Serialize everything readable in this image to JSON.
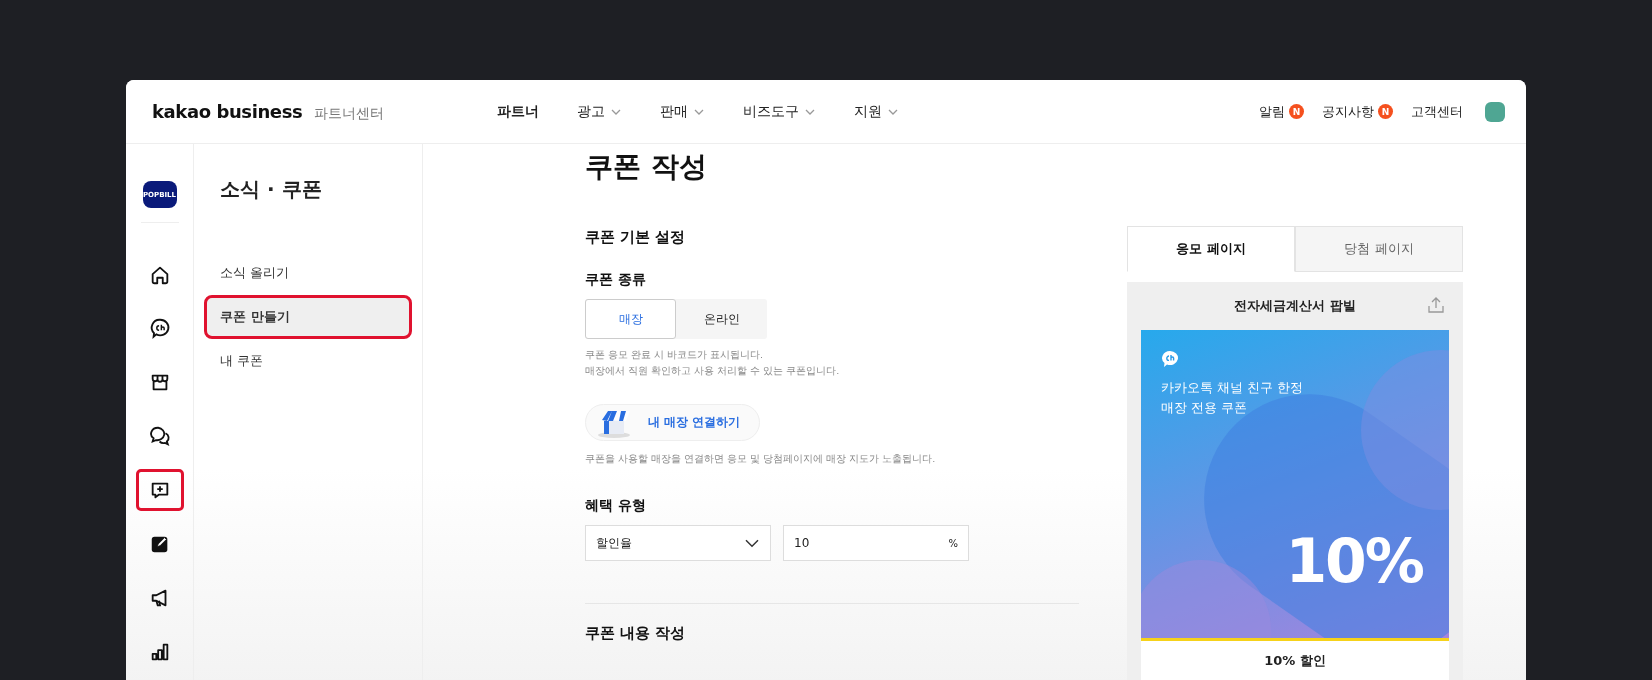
{
  "header": {
    "logo": "kakao business",
    "logo_sub": "파트너센터",
    "nav": [
      {
        "label": "파트너",
        "selected": true,
        "has_menu": false
      },
      {
        "label": "광고",
        "selected": false,
        "has_menu": true
      },
      {
        "label": "판매",
        "selected": false,
        "has_menu": true
      },
      {
        "label": "비즈도구",
        "selected": false,
        "has_menu": true
      },
      {
        "label": "지원",
        "selected": false,
        "has_menu": true
      }
    ],
    "utility": [
      {
        "label": "알림",
        "badge": "N"
      },
      {
        "label": "공지사항",
        "badge": "N"
      },
      {
        "label": "고객센터"
      }
    ]
  },
  "rail": {
    "brand_logo": "POPBILL",
    "items": [
      {
        "kind": "home",
        "selected": false
      },
      {
        "kind": "channel",
        "selected": false
      },
      {
        "kind": "store",
        "selected": false
      },
      {
        "kind": "chat",
        "selected": false
      },
      {
        "kind": "add-message",
        "selected": true
      },
      {
        "kind": "edit",
        "selected": false
      },
      {
        "kind": "megaphone",
        "selected": false
      },
      {
        "kind": "stats",
        "selected": false
      }
    ]
  },
  "subnav": {
    "title": "소식 · 쿠폰",
    "items": [
      {
        "label": "소식 올리기",
        "selected": false
      },
      {
        "label": "쿠폰 만들기",
        "selected": true
      },
      {
        "label": "내 쿠폰",
        "selected": false
      }
    ]
  },
  "form": {
    "title": "쿠폰 작성",
    "section": "쿠폰 기본 설정",
    "coupon_type": {
      "label": "쿠폰 종류",
      "options": [
        {
          "label": "매장",
          "selected": true
        },
        {
          "label": "온라인",
          "selected": false
        }
      ],
      "help": [
        "쿠폰 응모 완료 시 바코드가 표시됩니다.",
        "매장에서 직원 확인하고 사용 처리할 수 있는 쿠폰입니다."
      ]
    },
    "store_button": "내 매장 연결하기",
    "store_help": "쿠폰을 사용할 매장을 연결하면 응모 및 당첨페이지에 매장 지도가 노출됩니다.",
    "benefit": {
      "label": "혜택 유형",
      "type": "할인율",
      "value": "10",
      "unit": "%"
    },
    "section2": "쿠폰 내용 작성"
  },
  "preview": {
    "tabs": [
      {
        "label": "응모 페이지",
        "selected": true
      },
      {
        "label": "당첨 페이지",
        "selected": false
      }
    ],
    "title": "전자세금계산서 팝빌",
    "card": {
      "lines": [
        "카카오톡 채널 친구 한정",
        "매장 전용 쿠폰"
      ],
      "big": "10%"
    },
    "footer": [
      "10% 할인"
    ]
  }
}
